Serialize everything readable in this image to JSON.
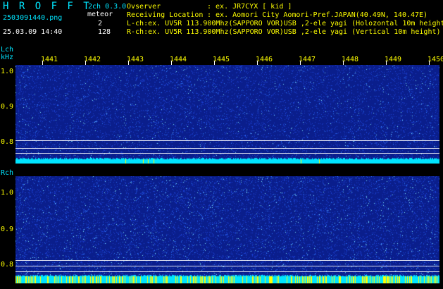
{
  "header": {
    "app_title": "H R O F F T",
    "filename": "2503091440.png",
    "datetime": "25.03.09 14:40",
    "mode": "2ch 0.3.0",
    "meteor_label": "meteor",
    "lch_count": "2",
    "rch_count": "128",
    "observer_label": "Ovserver",
    "observer_value": ": ex. JR7CYX [ kid ]",
    "location_label": "Receiving Location",
    "location_value": ": ex. Aomori City Aomori-Pref.JAPAN(40.49N, 140.47E)",
    "lch_info": "L-ch:ex. UV5R 113.900Mhz(SAPPORO VOR)USB ,2-ele yagi (Holozontal 10m height",
    "rch_info": "R-ch:ex. UV5R 113.900Mhz(SAPPORO VOR)USB ,2-ele yagi (Vertical 10m height)"
  },
  "lch": {
    "label": "Lch",
    "unit": "kHz",
    "x_ticks": [
      "1441",
      "1442",
      "1443",
      "1444",
      "1445",
      "1446",
      "1447",
      "1448",
      "1449",
      "1450"
    ],
    "y_ticks": [
      "1.0",
      "0.9",
      "0.8"
    ]
  },
  "rch": {
    "label": "Rch",
    "y_ticks": [
      "1.0",
      "0.9",
      "0.8"
    ]
  },
  "colors": {
    "background": "#000000",
    "plot_background": "#0a1e8c",
    "noise_cyan": "#00e5ff",
    "noise_yellow": "#ffff00",
    "text_cyan": "#00e5ff",
    "text_yellow": "#ffff00"
  }
}
